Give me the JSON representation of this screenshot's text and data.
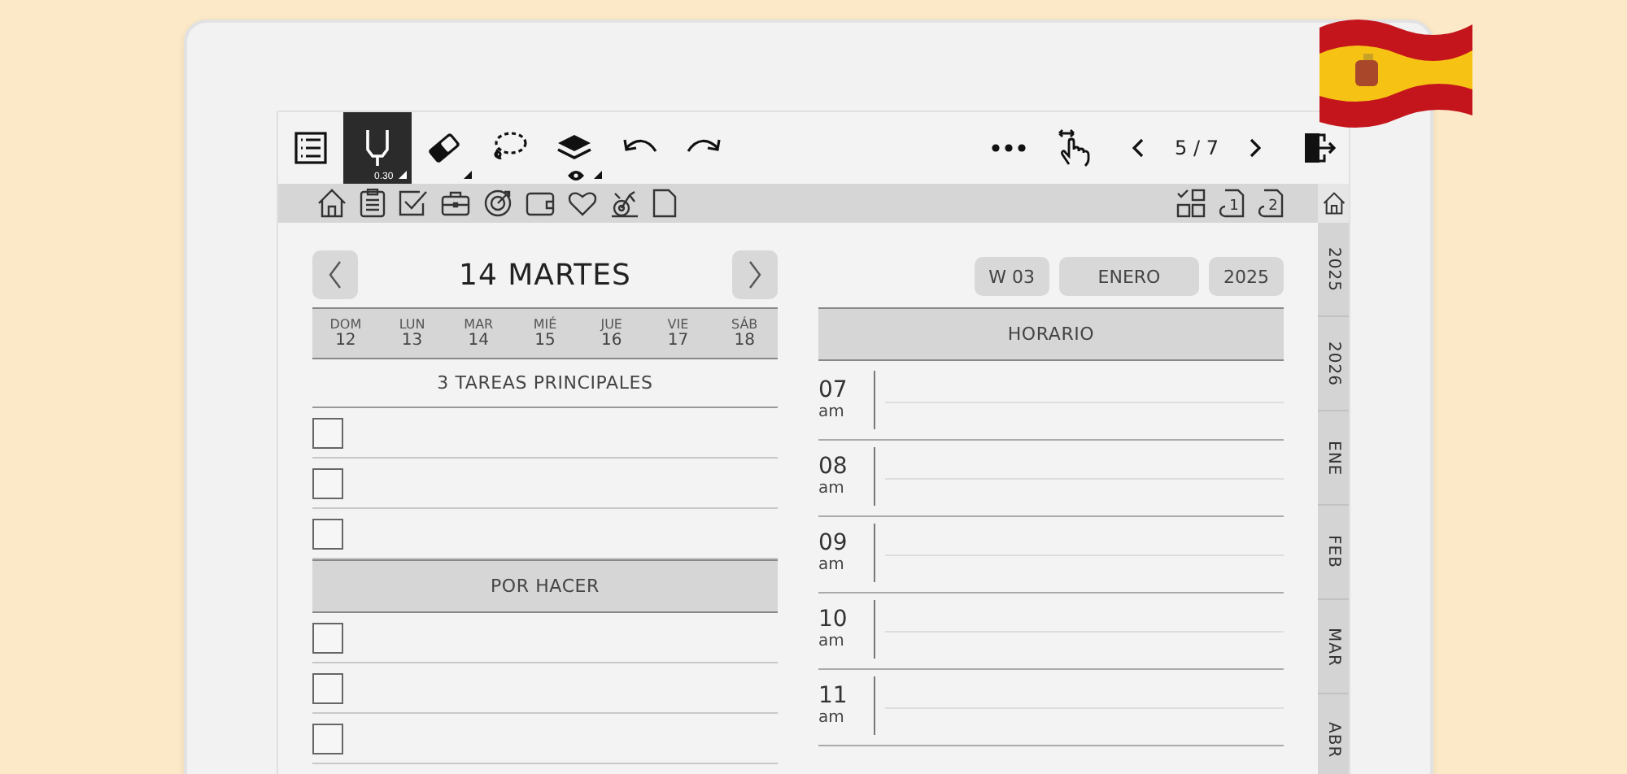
{
  "toolbar": {
    "tools": [
      {
        "kind": "toc",
        "selected": false
      },
      {
        "kind": "pen",
        "selected": true,
        "size": "0.30"
      },
      {
        "kind": "eraser",
        "selected": false
      },
      {
        "kind": "lasso",
        "selected": false
      },
      {
        "kind": "layers",
        "selected": false
      },
      {
        "kind": "undo",
        "selected": false
      },
      {
        "kind": "redo",
        "selected": false
      }
    ],
    "page_indicator": "5 / 7"
  },
  "nav_bar": {
    "left": [
      {
        "kind": "home"
      },
      {
        "kind": "clipboard"
      },
      {
        "kind": "check"
      },
      {
        "kind": "briefcase"
      },
      {
        "kind": "target"
      },
      {
        "kind": "wallet"
      },
      {
        "kind": "heart"
      },
      {
        "kind": "bike"
      },
      {
        "kind": "page"
      }
    ],
    "right": [
      {
        "kind": "grid"
      },
      {
        "kind": "numbered-page",
        "label": "1"
      },
      {
        "kind": "numbered-page",
        "label": "2"
      }
    ]
  },
  "side_tabs": [
    "2025",
    "2026",
    "ENE",
    "FEB",
    "MAR",
    "ABR"
  ],
  "day": {
    "title": "14 MARTES",
    "week": [
      {
        "name": "DOM",
        "date": "12"
      },
      {
        "name": "LUN",
        "date": "13"
      },
      {
        "name": "MAR",
        "date": "14"
      },
      {
        "name": "MIÉ",
        "date": "15"
      },
      {
        "name": "JUE",
        "date": "16"
      },
      {
        "name": "VIE",
        "date": "17"
      },
      {
        "name": "SÁB",
        "date": "18"
      }
    ]
  },
  "top_tasks": {
    "title": "3 TAREAS PRINCIPALES",
    "items": [
      {
        "checked": false
      },
      {
        "checked": false
      },
      {
        "checked": false
      }
    ]
  },
  "todo": {
    "title": "POR HACER",
    "items": [
      {
        "checked": false
      },
      {
        "checked": false
      },
      {
        "checked": false
      }
    ]
  },
  "pills": [
    "W 03",
    "ENERO",
    "2025"
  ],
  "schedule": {
    "title": "HORARIO",
    "hours": [
      {
        "hour": "07",
        "period": "am"
      },
      {
        "hour": "08",
        "period": "am"
      },
      {
        "hour": "09",
        "period": "am"
      },
      {
        "hour": "10",
        "period": "am"
      },
      {
        "hour": "11",
        "period": "am"
      }
    ]
  }
}
